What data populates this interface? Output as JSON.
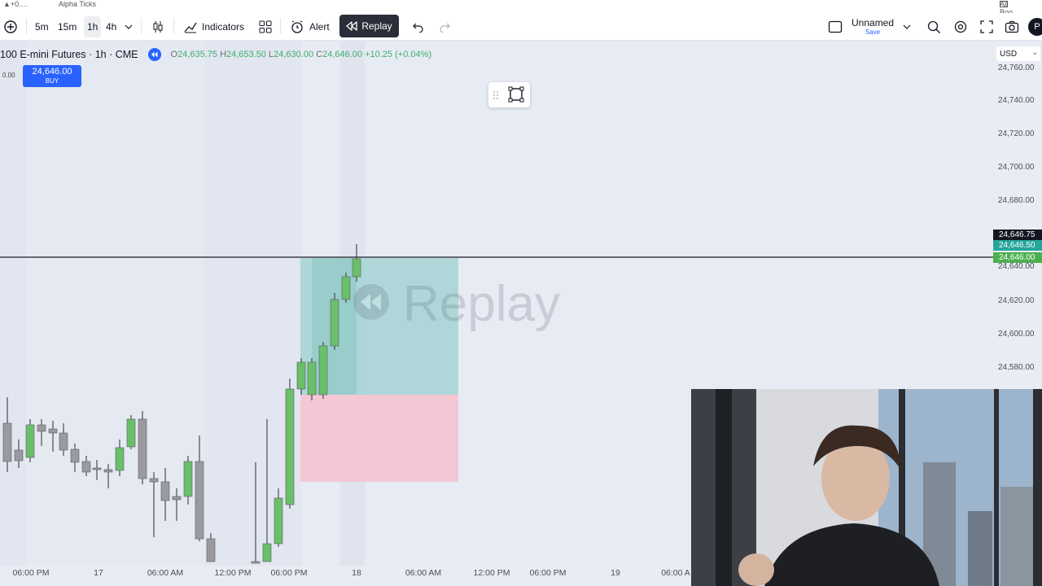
{
  "top_strip": {
    "left_text": "▲+0.…",
    "center_text": "Alpha Ticks",
    "right_text": "All Boo"
  },
  "toolbar": {
    "intervals": [
      {
        "label": "5m"
      },
      {
        "label": "15m"
      },
      {
        "label": "1h",
        "active": true
      },
      {
        "label": "4h"
      }
    ],
    "indicators_label": "Indicators",
    "alert_label": "Alert",
    "replay_label": "Replay",
    "layout_name": "Unnamed",
    "layout_sub": "Save",
    "profile_initial": "P"
  },
  "legend": {
    "symbol": "100 E-mini Futures · 1h · CME",
    "open_label": "O",
    "open": "24,635.75",
    "high_label": "H",
    "high": "24,653.50",
    "low_label": "L",
    "low": "24,630.00",
    "close_label": "C",
    "close": "24,646.00",
    "change": "+10.25 (+0.04%)"
  },
  "order": {
    "left_value": "0.00",
    "price": "24,646.00",
    "side": "BUY"
  },
  "watermark": "Replay",
  "currency": "USD",
  "price_ticks": [
    "24,760.00",
    "24,740.00",
    "24,720.00",
    "24,700.00",
    "24,680.00",
    "24,640.00",
    "24,620.00",
    "24,600.00",
    "24,580.00"
  ],
  "price_tags": [
    {
      "value": "24,646.75",
      "color": "#131722"
    },
    {
      "value": "24,646.50",
      "color": "#26a69a"
    },
    {
      "value": "24,646.00",
      "color": "#4caf50"
    }
  ],
  "time_labels": [
    "06:00 PM",
    "17",
    "06:00 AM",
    "12:00 PM",
    "06:00 PM",
    "18",
    "06:00 AM",
    "12:00 PM",
    "06:00 PM",
    "19",
    "06:00 A"
  ],
  "colors": {
    "up": "#6abf69",
    "down": "#9a9aa0",
    "profit_zone": "#a5d3d3",
    "loss_zone": "#f3c7d4"
  },
  "webcam": {
    "description": "presenter camera overlay"
  }
}
